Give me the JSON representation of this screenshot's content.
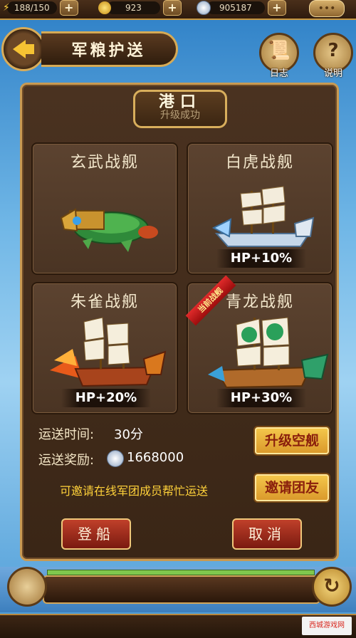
{
  "resources": {
    "stamina": "188/150",
    "gold": "923",
    "silver": "905187"
  },
  "header": {
    "title": "军粮护送",
    "log_label": "日志",
    "help_label": "说明"
  },
  "panel": {
    "plaque_title": "港口",
    "plaque_subtitle": "升级成功"
  },
  "ships": [
    {
      "name": "玄武战舰",
      "hp": ""
    },
    {
      "name": "白虎战舰",
      "hp": "HP+10%"
    },
    {
      "name": "朱雀战舰",
      "hp": "HP+20%"
    },
    {
      "name": "青龙战舰",
      "hp": "HP+30%",
      "ribbon": "当前战舰"
    }
  ],
  "info": {
    "time_label": "运送时间:",
    "time_value": "30分",
    "reward_label": "运送奖励:",
    "reward_value": "1668000",
    "invite_text": "可邀请在线军团成员帮忙运送"
  },
  "buttons": {
    "upgrade": "升级空舰",
    "invite": "邀请团友",
    "board": "登船",
    "cancel": "取消"
  },
  "watermark": "西城游戏网",
  "colors": {
    "gold_button": "#e8b13c",
    "red_button": "#a6311f",
    "panel_bg": "#4a3220",
    "accent_yellow": "#ffd23a"
  }
}
